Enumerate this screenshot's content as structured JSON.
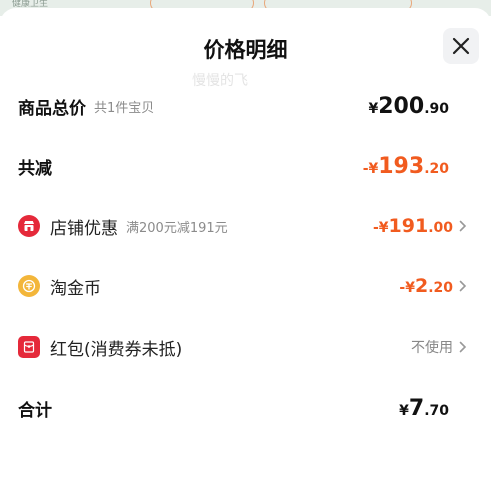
{
  "header": {
    "title": "价格明细",
    "watermark": "慢慢的飞"
  },
  "background_strip": {
    "hint": "健康卫生"
  },
  "rows": {
    "goods_total": {
      "label": "商品总价",
      "note": "共1件宝贝",
      "prefix": "¥",
      "int": "200",
      "dec": ".90"
    },
    "total_discount": {
      "label": "共减",
      "prefix": "-¥",
      "int": "193",
      "dec": ".20"
    },
    "shop_discount": {
      "label": "店铺优惠",
      "note": "满200元减191元",
      "prefix": "-¥",
      "int": "191",
      "dec": ".00"
    },
    "taojinbi": {
      "label": "淘金币",
      "prefix": "-¥",
      "int": "2",
      "dec": ".20"
    },
    "red_packet": {
      "label": "红包(消费券未抵)",
      "value": "不使用"
    },
    "grand_total": {
      "label": "合计",
      "prefix": "¥",
      "int": "7",
      "dec": ".70"
    }
  },
  "colors": {
    "accent_orange": "#f15b1f",
    "icon_red": "#e5293a",
    "coin_gold": "#f3b63a"
  },
  "icons": [
    "close-icon",
    "shop-icon",
    "coin-icon",
    "red-packet-icon",
    "chevron-right-icon"
  ]
}
